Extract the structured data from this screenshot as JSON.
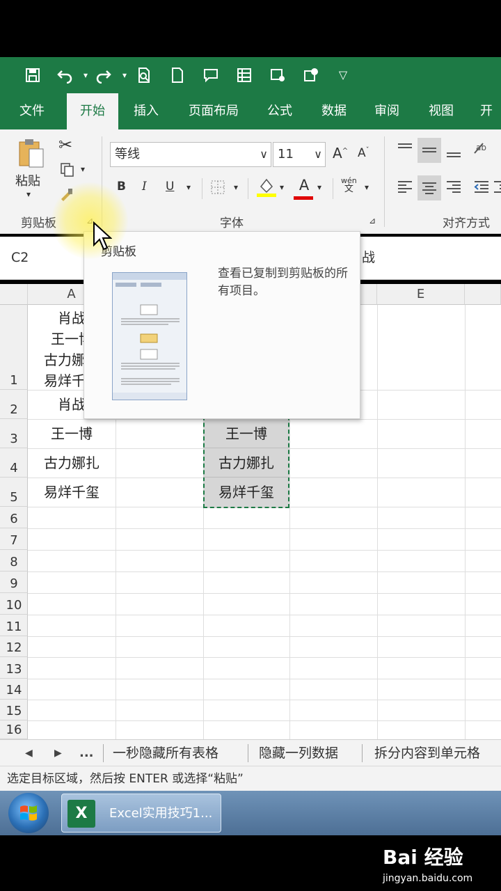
{
  "quick_access": {
    "icons": [
      "save-icon",
      "undo-icon",
      "redo-icon",
      "print-preview-icon",
      "new-file-icon",
      "comment-icon",
      "form-icon",
      "screenshot-icon",
      "share-icon",
      "customize-icon"
    ]
  },
  "tabs": [
    "文件",
    "开始",
    "插入",
    "页面布局",
    "公式",
    "数据",
    "审阅",
    "视图",
    "开发"
  ],
  "active_tab": "开始",
  "ribbon": {
    "paste_label": "粘贴",
    "clipboard_group": "剪贴板",
    "font_group": "字体",
    "align_group": "对齐方式",
    "font_name": "等线",
    "font_size": "11",
    "bold": "B",
    "italic": "I",
    "underline": "U",
    "grow_font": "A",
    "shrink_font": "A",
    "font_color": "A",
    "wen": "wén",
    "wen_char": "文"
  },
  "formula_bar": {
    "name_box": "C2",
    "value_fragment": "战"
  },
  "columns": [
    "A",
    "E"
  ],
  "rows": [
    "1",
    "2",
    "3",
    "4",
    "5",
    "6",
    "7",
    "8",
    "9",
    "10",
    "11",
    "12",
    "13",
    "14",
    "15",
    "16"
  ],
  "cells": {
    "a1_line1": "肖战",
    "a1_line2": "王一博",
    "a1_line3": "古力娜扎",
    "a1_line4": "易烊千玺",
    "a2": "肖战",
    "a3": "王一博",
    "a4": "古力娜扎",
    "a5": "易烊千玺",
    "c3": "王一博",
    "c4": "古力娜扎",
    "c5": "易烊千玺"
  },
  "tooltip": {
    "title": "剪贴板",
    "description": "查看已复制到剪贴板的所有项目。"
  },
  "sheet_tabs": {
    "ellipsis": "...",
    "sheets": [
      "一秒隐藏所有表格",
      "隐藏一列数据",
      "拆分内容到单元格"
    ]
  },
  "status_text": "选定目标区域，然后按 ENTER 或选择“粘贴”",
  "taskbar": {
    "item_label": "Excel实用技巧1..."
  },
  "watermark": {
    "logo": "Bai 经验",
    "url": "jingyan.baidu.com"
  },
  "colors": {
    "excel_green": "#1d7a45",
    "ribbon_bg": "#f3f3f3"
  }
}
